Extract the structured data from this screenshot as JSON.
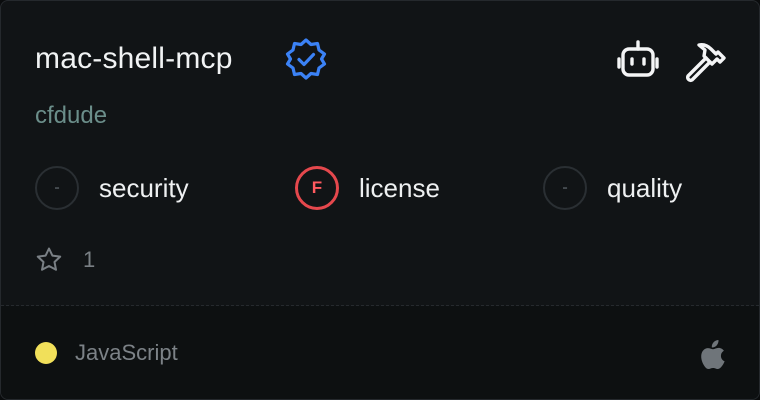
{
  "package": {
    "name": "mac-shell-mcp",
    "author": "cfdude",
    "verified_icon": "verified-badge-icon"
  },
  "header_icons": [
    "robot-icon",
    "hammer-icon"
  ],
  "metrics": [
    {
      "grade": "-",
      "label": "security",
      "status": "none"
    },
    {
      "grade": "F",
      "label": "license",
      "status": "fail"
    },
    {
      "grade": "-",
      "label": "quality",
      "status": "none"
    }
  ],
  "stars": {
    "count": "1",
    "icon": "star-icon"
  },
  "footer": {
    "language": "JavaScript",
    "language_color": "#f1e05a",
    "platform_icon": "apple-icon"
  },
  "colors": {
    "verified": "#3b82f6",
    "fail": "#e5484d",
    "author": "#6b8e8a"
  }
}
